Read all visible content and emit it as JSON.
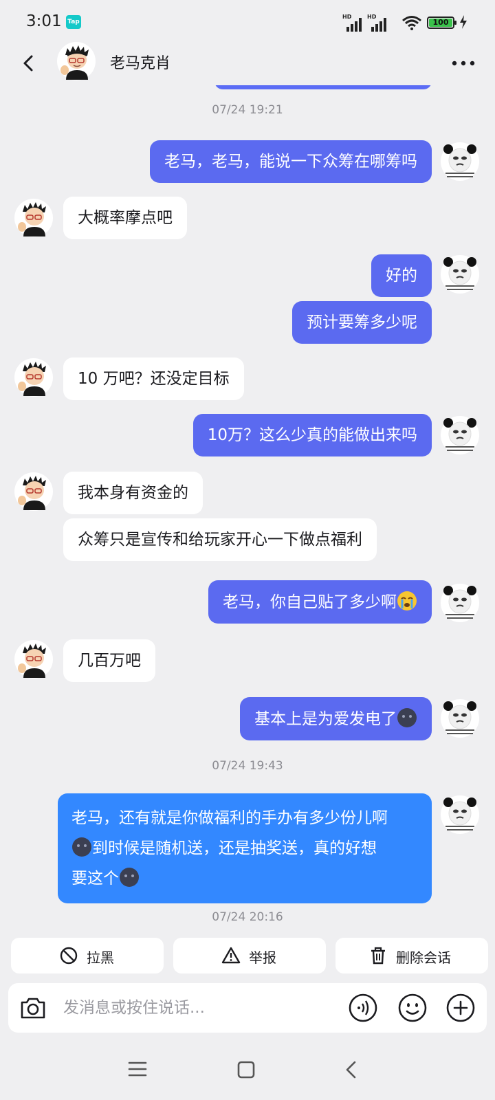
{
  "status_bar": {
    "time": "3:01",
    "app_badge": "Tap",
    "signal_label_1": "HD",
    "signal_label_2": "HD",
    "battery": "100"
  },
  "header": {
    "title": "老马克肖",
    "back_icon": "chevron-left-icon",
    "more_icon": "more-dots-icon"
  },
  "colors": {
    "my_bubble": "#5b6af0",
    "my_bubble_latest": "#3388ff",
    "their_bubble": "#ffffff",
    "background": "#efeff1"
  },
  "timestamps": [
    "07/24 19:21",
    "07/24 19:43",
    "07/24 20:16"
  ],
  "messages": [
    {
      "from": "me",
      "text": "老马，老马，能说一下众筹在哪筹吗"
    },
    {
      "from": "them",
      "text": "大概率摩点吧"
    },
    {
      "from": "me",
      "text": "好的"
    },
    {
      "from": "me",
      "text": "预计要筹多少呢"
    },
    {
      "from": "them",
      "text": "10 万吧？还没定目标"
    },
    {
      "from": "me",
      "text": "10万？这么少真的能做出来吗"
    },
    {
      "from": "them",
      "text": "我本身有资金的"
    },
    {
      "from": "them",
      "text": "众筹只是宣传和给玩家开心一下做点福利"
    },
    {
      "from": "me",
      "text": "老马，你自己贴了多少啊",
      "emoji": "crying-face-emoji"
    },
    {
      "from": "them",
      "text": "几百万吧"
    },
    {
      "from": "me",
      "text": "基本上是为爱发电了",
      "emoji": "dark-face-emoji"
    },
    {
      "from": "me",
      "line1": "老马，还有就是你做福利的手办有多少份儿啊",
      "line2": "到时候是随机送，还是抽奖送，真的好想",
      "line3": "要这个"
    }
  ],
  "actions": {
    "block": "拉黑",
    "report": "举报",
    "delete": "删除会话"
  },
  "input": {
    "placeholder": "发消息或按住说话..."
  }
}
